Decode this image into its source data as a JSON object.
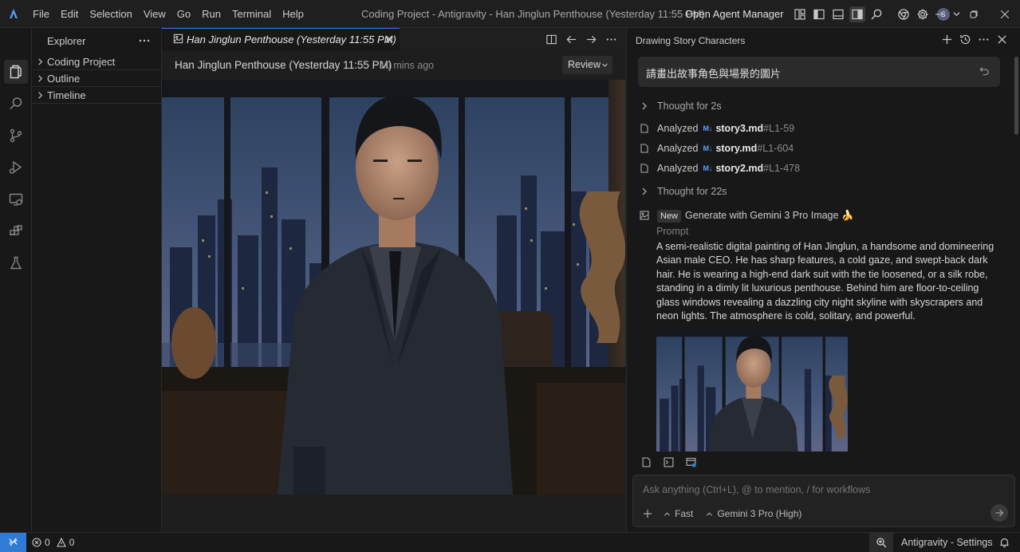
{
  "window": {
    "title": "Coding Project - Antigravity - Han Jinglun Penthouse (Yesterday 11:55 PM)",
    "open_agent_manager": "Open Agent Manager",
    "avatar_initial": "S"
  },
  "menu": [
    "File",
    "Edit",
    "Selection",
    "View",
    "Go",
    "Run",
    "Terminal",
    "Help"
  ],
  "explorer": {
    "title": "Explorer",
    "items": [
      {
        "label": "Coding Project"
      },
      {
        "label": "Outline"
      },
      {
        "label": "Timeline"
      }
    ]
  },
  "editor": {
    "tab_label": "Han Jinglun Penthouse (Yesterday 11:55 PM)",
    "header_title": "Han Jinglun Penthouse (Yesterday 11:55 PM)",
    "header_time": "10 mins ago",
    "review_label": "Review"
  },
  "agent": {
    "panel_title": "Drawing Story Characters",
    "user_message": "請畫出故事角色與場景的圖片",
    "thought1": "Thought for 2s",
    "analyzed": [
      {
        "verb": "Analyzed",
        "badge": "M↓",
        "file": "story3.md",
        "range": "#L1-59"
      },
      {
        "verb": "Analyzed",
        "badge": "M↓",
        "file": "story.md",
        "range": "#L1-604"
      },
      {
        "verb": "Analyzed",
        "badge": "M↓",
        "file": "story2.md",
        "range": "#L1-478"
      }
    ],
    "thought2": "Thought for 22s",
    "generate": {
      "badge": "New",
      "label": "Generate with Gemini 3 Pro Image",
      "emoji": "🍌"
    },
    "prompt_label": "Prompt",
    "prompt_text": "A semi-realistic digital painting of Han Jinglun, a handsome and domineering Asian male CEO. He has sharp features, a cold gaze, and swept-back dark hair. He is wearing a high-end dark suit with the tie loosened, or a silk robe, standing in a dimly lit luxurious penthouse. Behind him are floor-to-ceiling glass windows revealing a dazzling city night skyline with skyscrapers and neon lights. The atmosphere is cold, solitary, and powerful.",
    "input_placeholder": "Ask anything (Ctrl+L), @ to mention, / for workflows",
    "mode_label": "Fast",
    "model_label": "Gemini 3 Pro (High)"
  },
  "status": {
    "errors": "0",
    "warnings": "0",
    "settings_label": "Antigravity - Settings"
  },
  "colors": {
    "accent": "#2f7bd6",
    "background": "#181818",
    "editor_bg": "#1e1e1e",
    "input_bg": "#222222",
    "markdown_badge": "#5aa0ff"
  },
  "icons": [
    "antigravity-logo-icon",
    "layout-icons",
    "search-icon",
    "chrome-icon",
    "gear-icon",
    "explorer-files-icon",
    "source-control-icon",
    "run-debug-icon",
    "remote-explorer-icon",
    "extensions-icon",
    "testing-flask-icon",
    "image-icon",
    "split-editor-icon",
    "arrow-left-icon",
    "arrow-right-icon",
    "plus-icon",
    "history-icon",
    "close-icon",
    "file-icon",
    "send-arrow-icon",
    "bell-icon",
    "zoom-icon"
  ]
}
